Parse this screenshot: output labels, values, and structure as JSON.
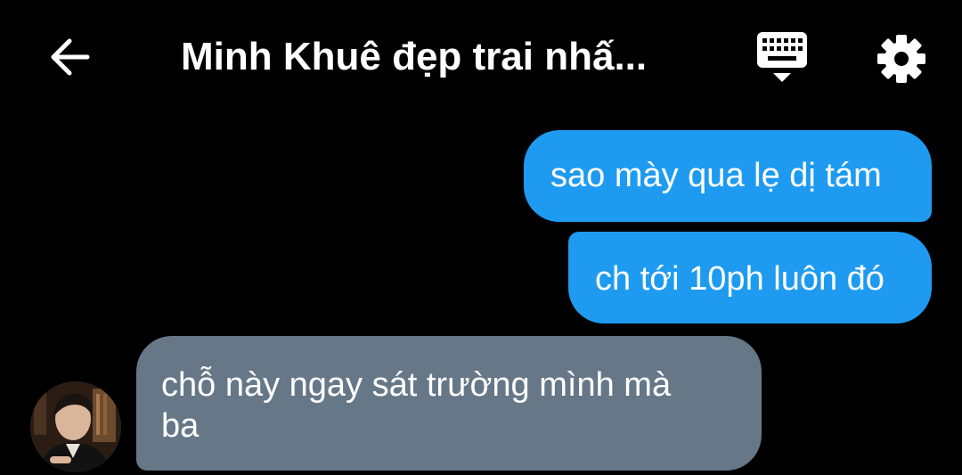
{
  "header": {
    "back_icon": "arrow-left-icon",
    "title": "Minh Khuê đẹp trai nhấ...",
    "keyboard_icon": "keyboard-icon",
    "settings_icon": "gear-icon"
  },
  "messages": [
    {
      "direction": "outgoing",
      "text": "sao mày qua lẹ dị tám"
    },
    {
      "direction": "outgoing",
      "text": "ch tới 10ph luôn đó"
    },
    {
      "direction": "incoming",
      "text": "chỗ này ngay sát trường mình mà ba"
    }
  ],
  "colors": {
    "background": "#000000",
    "outgoing_bubble": "#1e9bf0",
    "incoming_bubble": "#667788",
    "text": "#ffffff"
  }
}
